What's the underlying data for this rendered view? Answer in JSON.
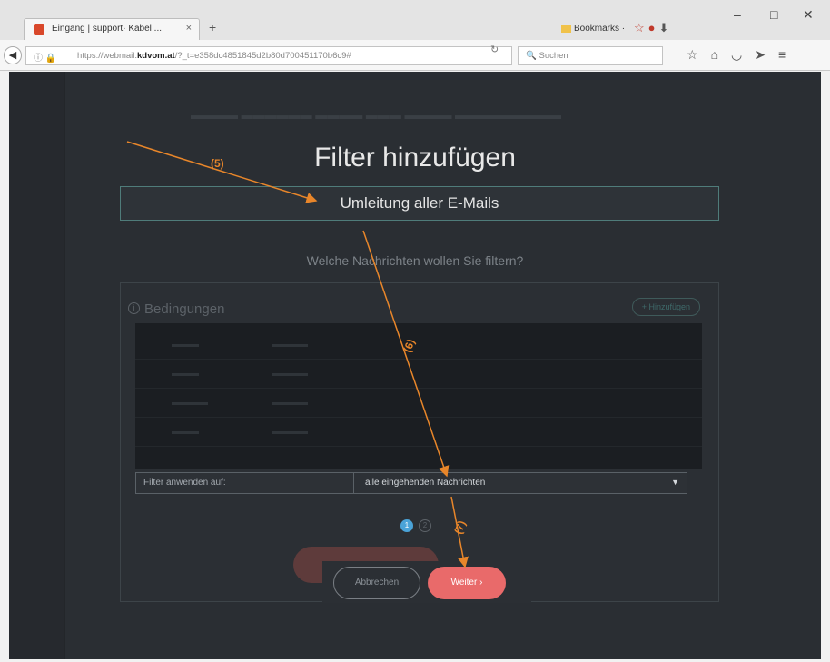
{
  "browser": {
    "tab_title": "Eingang | support· Kabel ...",
    "tab_close": "×",
    "new_tab": "+",
    "bookmarks_label": "Bookmarks ·",
    "url_prefix": "https://webmail.",
    "url_domain": "kdvom.at",
    "url_suffix": "/?_t=e358dc4851845d2b80d700451170b6c9#",
    "search_placeholder": "Suchen"
  },
  "modal": {
    "title": "Filter hinzufügen",
    "filter_name_value": "Umleitung aller E-Mails",
    "question": "Welche Nachrichten wollen Sie filtern?",
    "conditions_title": "Bedingungen",
    "add_button": "+ Hinzufügen",
    "apply_label": "Filter anwenden auf:",
    "apply_value": "alle eingehenden Nachrichten",
    "step_1": "1",
    "step_2": "2",
    "cancel_button": "Abbrechen",
    "next_button": "Weiter ›"
  },
  "annotations": {
    "label_5": "(5)",
    "label_6": "(6)",
    "label_7": "(7)",
    "arrow_color": "#e8862a"
  },
  "colors": {
    "modal_background": "#2a2e33",
    "accent_button": "#e96a6a",
    "input_border": "#4f7c7a",
    "step_active": "#4aa3d8"
  }
}
